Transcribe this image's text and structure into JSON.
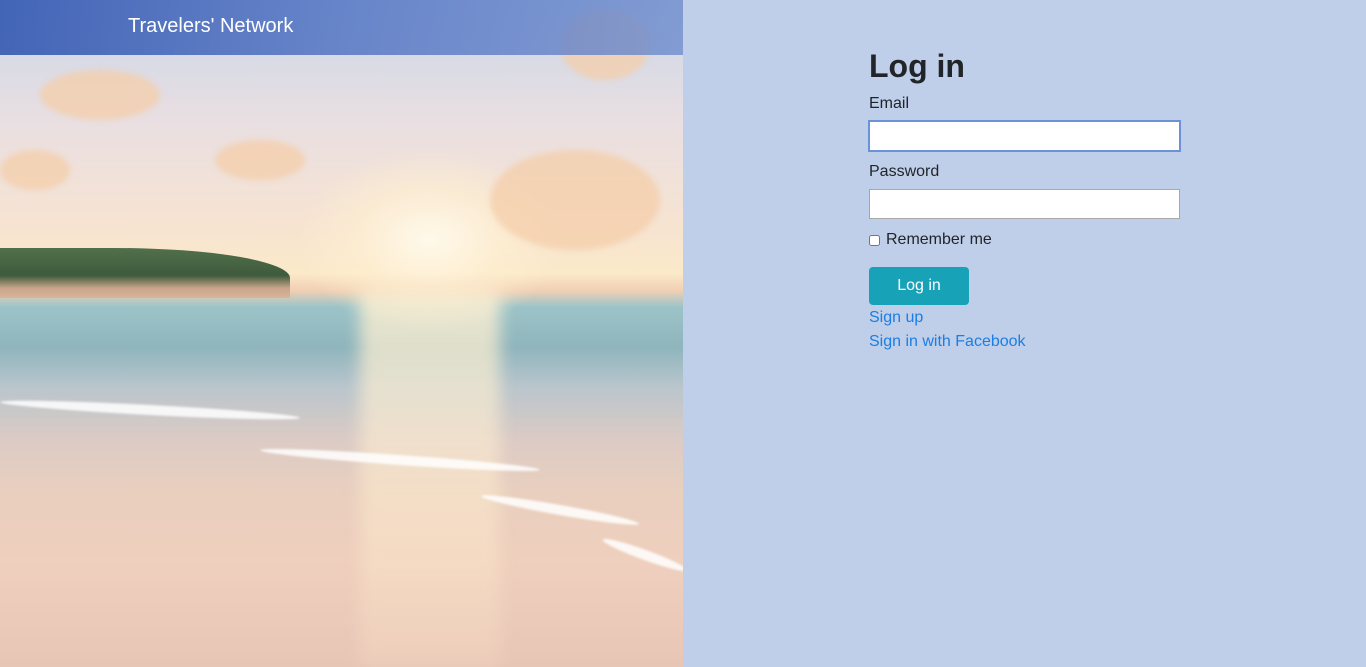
{
  "header": {
    "brand": "Travelers' Network"
  },
  "login": {
    "title": "Log in",
    "email_label": "Email",
    "email_value": "",
    "password_label": "Password",
    "password_value": "",
    "remember_label": "Remember me",
    "remember_checked": false,
    "submit_label": "Log in",
    "signup_link": "Sign up",
    "facebook_link": "Sign in with Facebook"
  },
  "colors": {
    "page_background": "#bfcfe9",
    "header_bar": "#4a6bbd",
    "primary_button": "#17a2b8",
    "link": "#1a7ee6"
  },
  "hero_image": {
    "subject": "beach-sunset-photo"
  }
}
